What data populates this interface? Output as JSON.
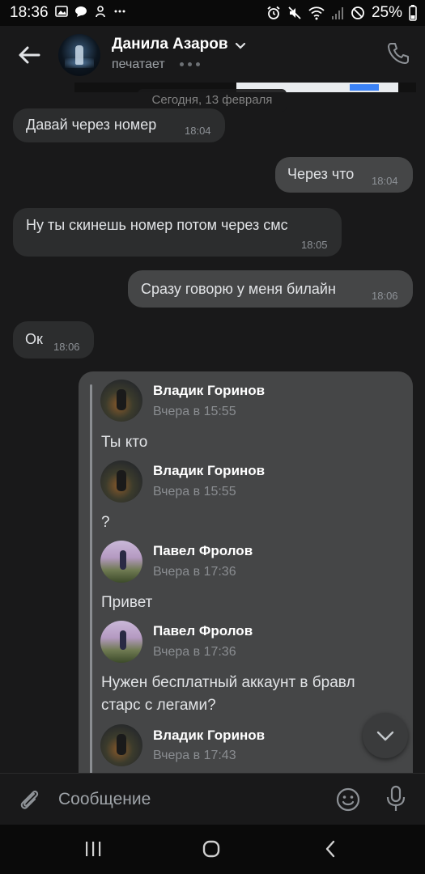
{
  "status_bar": {
    "time": "18:36",
    "battery": "25%",
    "left_icons": [
      "gallery-icon",
      "chat-icon",
      "app-icon",
      "more-icon"
    ],
    "right_icons": [
      "alarm-icon",
      "mute-icon",
      "wifi-icon",
      "signal-icon",
      "dnd-icon"
    ]
  },
  "header": {
    "contact_name": "Данила Азаров",
    "status": "печатает"
  },
  "date_separator": "Сегодня, 13 февраля",
  "messages": [
    {
      "direction": "in",
      "text": "Давай через номер",
      "time": "18:04"
    },
    {
      "direction": "out",
      "text": "Через что",
      "time": "18:04"
    },
    {
      "direction": "in",
      "text": "Ну ты скинешь номер потом через смс",
      "time": "18:05"
    },
    {
      "direction": "out",
      "text": "Сразу говорю у меня билайн",
      "time": "18:06"
    },
    {
      "direction": "in",
      "text": "Ок",
      "time": "18:06"
    }
  ],
  "forwarded": [
    {
      "author": "Владик Горинов",
      "time": "Вчера в 15:55",
      "text": "Ты кто"
    },
    {
      "author": "Владик Горинов",
      "time": "Вчера в 15:55",
      "text": "?"
    },
    {
      "author": "Павел Фролов",
      "time": "Вчера в 17:36",
      "text": "Привет"
    },
    {
      "author": "Павел Фролов",
      "time": "Вчера в 17:36",
      "text": "Нужен бесплатный аккаунт в бравл старс с легами?"
    },
    {
      "author": "Владик Горинов",
      "time": "Вчера в 17:43",
      "text": ""
    }
  ],
  "composer": {
    "placeholder": "Сообщение"
  },
  "colors": {
    "background": "#19191a",
    "incoming_bubble": "#2c2d2e",
    "outgoing_bubble": "#454647",
    "forwarded_bar": "#8a8d91"
  }
}
